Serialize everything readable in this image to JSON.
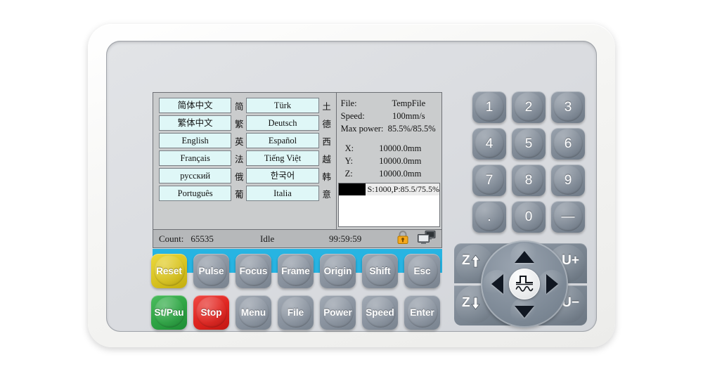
{
  "device": {
    "name": "laser-engraver-control-panel"
  },
  "screen": {
    "languages": [
      {
        "label": "简体中文",
        "cjk": "简"
      },
      {
        "label": "Türk",
        "cjk": "土"
      },
      {
        "label": "繁体中文",
        "cjk": "繁"
      },
      {
        "label": "Deutsch",
        "cjk": "德"
      },
      {
        "label": "English",
        "cjk": "英"
      },
      {
        "label": "Español",
        "cjk": "西"
      },
      {
        "label": "Français",
        "cjk": "法"
      },
      {
        "label": "Tiếng Việt",
        "cjk": "越"
      },
      {
        "label": "русский",
        "cjk": "俄"
      },
      {
        "label": "한국어",
        "cjk": "韩"
      },
      {
        "label": "Português",
        "cjk": "葡"
      },
      {
        "label": "Italia",
        "cjk": "意"
      }
    ],
    "info": {
      "file_label": "File:",
      "file_value": "TempFile",
      "speed_label": "Speed:",
      "speed_value": "100mm/s",
      "maxpower_label": "Max power:",
      "maxpower_value": "85.5%/85.5%",
      "x_label": "X:",
      "x_value": "10000.0mm",
      "y_label": "Y:",
      "y_value": "10000.0mm",
      "z_label": "Z:",
      "z_value": "10000.0mm"
    },
    "layers": [
      {
        "color": "#000000",
        "text": "S:1000,P:85.5/75.5%"
      }
    ],
    "status": {
      "count_label": "Count:",
      "count_value": "65535",
      "mode": "Idle",
      "time": "99:59:59",
      "lock_icon": "lock-icon",
      "network_icon": "network-monitors-icon"
    }
  },
  "keypad": {
    "row1": [
      {
        "label": "Reset",
        "style": "yellow"
      },
      {
        "label": "Pulse",
        "style": "gray"
      },
      {
        "label": "Focus",
        "style": "gray"
      },
      {
        "label": "Frame",
        "style": "gray"
      },
      {
        "label": "Origin",
        "style": "gray"
      },
      {
        "label": "Shift",
        "style": "gray"
      },
      {
        "label": "Esc",
        "style": "gray"
      }
    ],
    "row2": [
      {
        "label": "St/Pau",
        "style": "green"
      },
      {
        "label": "Stop",
        "style": "red"
      },
      {
        "label": "Menu",
        "style": "gray"
      },
      {
        "label": "File",
        "style": "gray"
      },
      {
        "label": "Power",
        "style": "gray"
      },
      {
        "label": "Speed",
        "style": "gray"
      },
      {
        "label": "Enter",
        "style": "gray"
      }
    ]
  },
  "numpad": {
    "keys": [
      "1",
      "2",
      "3",
      "4",
      "5",
      "6",
      "7",
      "8",
      "9",
      ".",
      "0",
      "—"
    ]
  },
  "dpad": {
    "z_up": "Z",
    "z_down": "Z",
    "u_plus": "U+",
    "u_minus": "U−",
    "up_icon": "arrow-up-icon",
    "down_icon": "arrow-down-icon",
    "left_icon": "arrow-left-icon",
    "right_icon": "arrow-right-icon",
    "center_icon": "pulse-waveform-icon"
  },
  "colors": {
    "accent_cyan": "#27b4e2",
    "lcd_bg": "#cacccd",
    "lang_btn": "#dff7f7",
    "reset_yellow": "#d9c422",
    "start_green": "#2ea544",
    "stop_red": "#e02621",
    "lock_orange": "#f5a81c"
  }
}
